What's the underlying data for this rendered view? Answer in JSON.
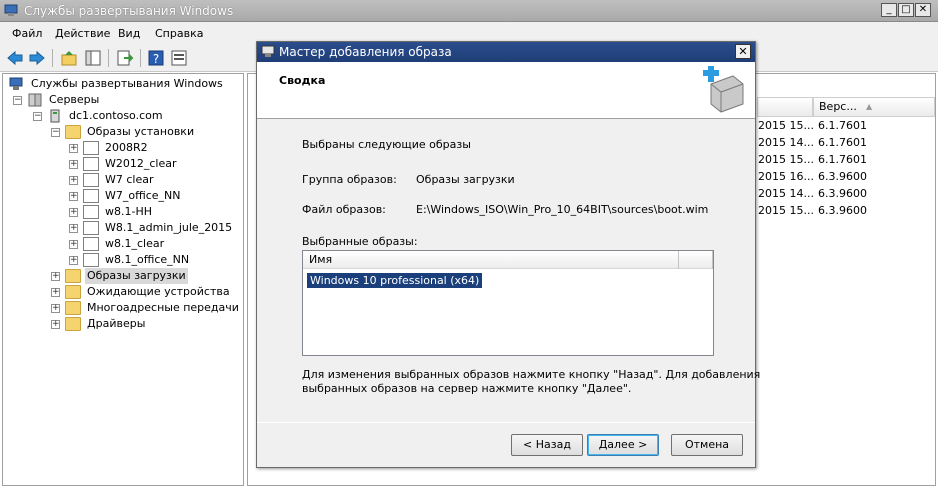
{
  "main_window": {
    "title": "Службы развертывания Windows",
    "buttons": {
      "minimize": "_",
      "maximize": "□",
      "close": "✕"
    }
  },
  "menu": {
    "items": [
      "Файл",
      "Действие",
      "Вид",
      "Справка"
    ]
  },
  "toolbar": {
    "icons": [
      "back-arrow-icon",
      "forward-arrow-icon",
      "up-folder-icon",
      "show-hide-tree-icon",
      "export-list-icon",
      "help-icon",
      "properties-icon"
    ]
  },
  "tree": {
    "root": "Службы развертывания Windows",
    "servers": "Серверы",
    "server_name": "dc1.contoso.com",
    "install_images": "Образы установки",
    "install_groups": [
      "2008R2",
      "W2012_clear",
      "W7 clear",
      "W7_office_NN",
      "w8.1-HH",
      "W8.1_admin_jule_2015",
      "w8.1_clear",
      "w8.1_office_NN"
    ],
    "boot_images": "Образы загрузки",
    "pending_devices": "Ожидающие устройства",
    "multicast": "Многоадресные передачи",
    "drivers": "Драйверы",
    "expand_symbol": "+",
    "collapse_symbol": "−"
  },
  "right_pane": {
    "version_header": "Верс...",
    "sort_glyph": "▲",
    "rows": [
      {
        "date": "2015 15...",
        "version": "6.1.7601"
      },
      {
        "date": "2015 14...",
        "version": "6.1.7601"
      },
      {
        "date": "2015 15...",
        "version": "6.1.7601"
      },
      {
        "date": "2015 16...",
        "version": "6.3.9600"
      },
      {
        "date": "2015 14...",
        "version": "6.3.9600"
      },
      {
        "date": "2015 15...",
        "version": "6.3.9600"
      }
    ]
  },
  "dialog": {
    "title": "Мастер добавления образа",
    "close_glyph": "✕",
    "heading": "Сводка",
    "intro": "Выбраны следующие образы",
    "group_label": "Группа образов:",
    "group_value": "Образы загрузки",
    "file_label": "Файл образов:",
    "file_value": "E:\\Windows_ISO\\Win_Pro_10_64BIT\\sources\\boot.wim",
    "selected_label": "Выбранные образы:",
    "list_header": "Имя",
    "list_items": [
      "Windows 10 professional (x64)"
    ],
    "hint_line1": "Для изменения выбранных образов нажмите кнопку \"Назад\". Для добавления",
    "hint_line2": "выбранных образов на сервер нажмите кнопку \"Далее\".",
    "buttons": {
      "back": "< Назад",
      "next": "Далее >",
      "cancel": "Отмена"
    }
  }
}
